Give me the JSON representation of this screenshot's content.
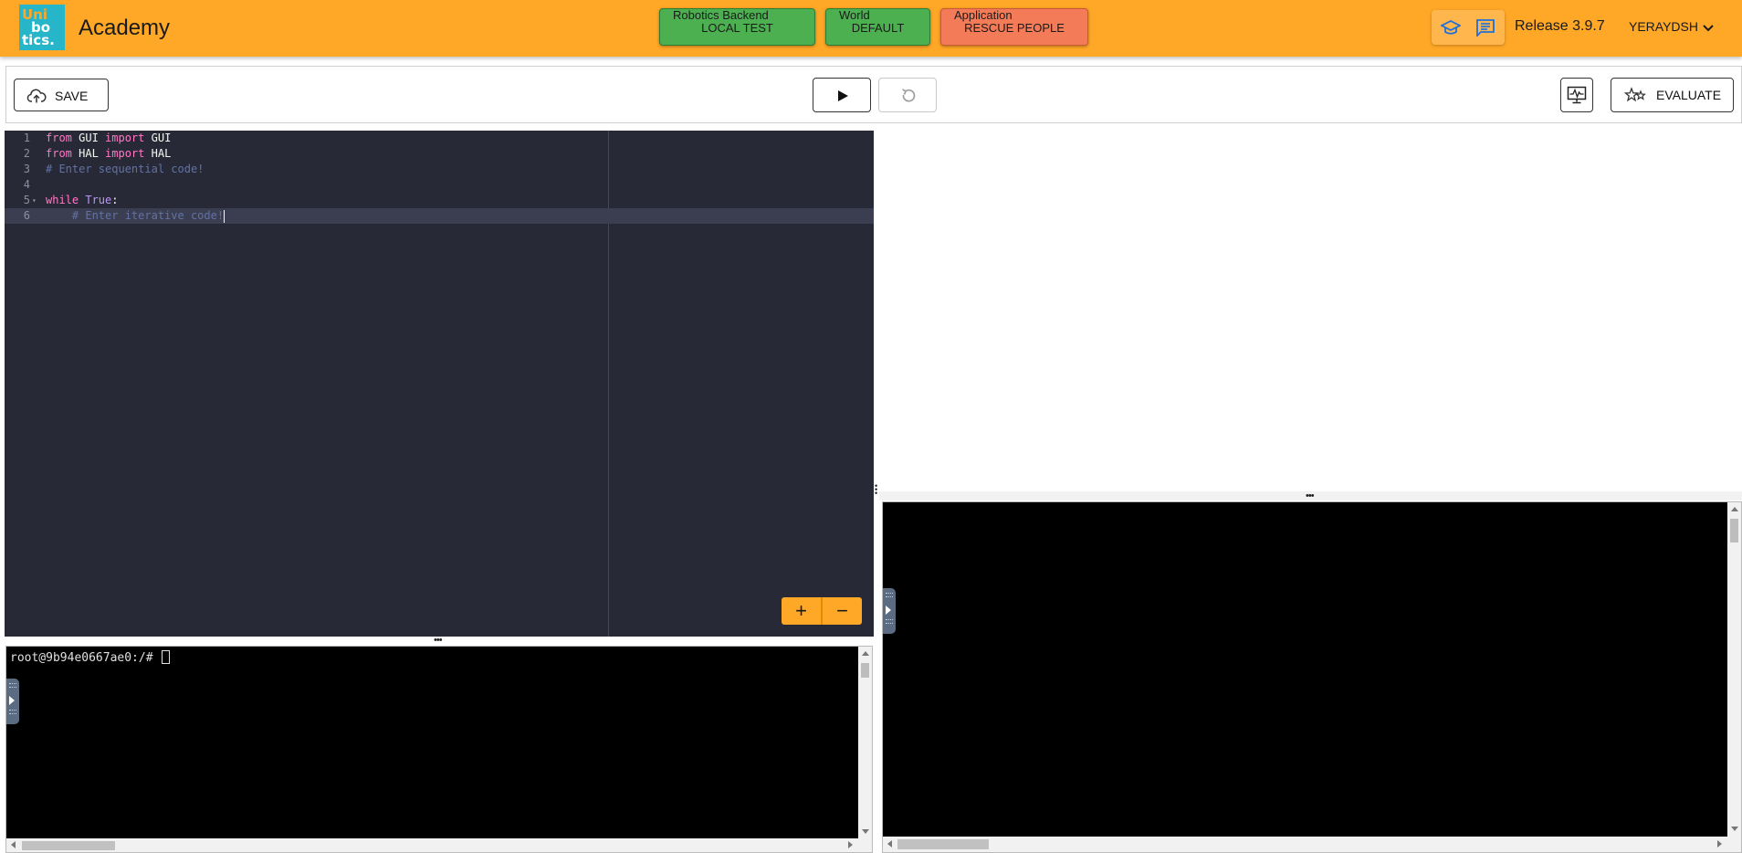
{
  "header": {
    "logo_lines": [
      "Uni",
      "bo",
      "tics."
    ],
    "app_title": "Academy",
    "backend": {
      "caption": "Robotics Backend",
      "value": "LOCAL TEST"
    },
    "world": {
      "caption": "World",
      "value": "DEFAULT"
    },
    "application": {
      "caption": "Application",
      "value": "RESCUE PEOPLE"
    },
    "icons": [
      "graduation-cap-icon",
      "chat-icon"
    ],
    "release": "Release 3.9.7",
    "username": "YERAYDSH"
  },
  "toolbar": {
    "save_label": "SAVE",
    "evaluate_label": "EVALUATE"
  },
  "editor": {
    "line_numbers": [
      "1",
      "2",
      "3",
      "4",
      "5",
      "6"
    ],
    "zoom_in": "+",
    "zoom_out": "−"
  },
  "terminal_left": {
    "prompt": "root@9b94e0667ae0:/# "
  },
  "colors": {
    "header_bg": "#ffa726",
    "backend_button": "#4caf50",
    "application_button": "#f47b58",
    "editor_bg": "#272936",
    "terminal_bg": "#000000"
  }
}
